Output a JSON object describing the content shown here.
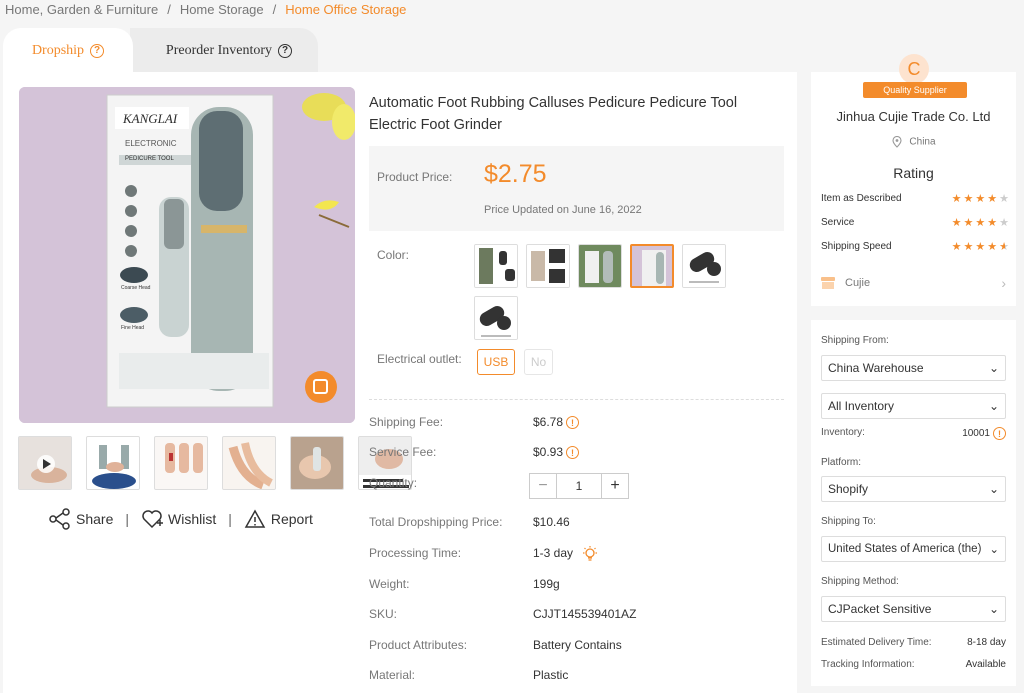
{
  "breadcrumb": {
    "items": [
      "Home, Garden & Furniture",
      "Home Storage"
    ],
    "current": "Home Office Storage",
    "separator": "/"
  },
  "tabs": [
    {
      "label": "Dropship",
      "active": true
    },
    {
      "label": "Preorder Inventory",
      "active": false
    }
  ],
  "colors": {
    "accent": "#f38b2b",
    "text": "#333333",
    "muted": "#777777"
  },
  "product": {
    "title": "Automatic Foot Rubbing Calluses Pedicure Pedicure Tool Electric Foot Grinder",
    "price_label": "Product Price:",
    "price": "$2.75",
    "price_updated": "Price Updated on June 16, 2022",
    "color_label": "Color:",
    "outlet_label": "Electrical outlet:",
    "outlet_options": [
      "USB",
      "No"
    ],
    "package_text": {
      "brand": "KANGLAI",
      "line1": "ELECTRONIC",
      "line2": "PEDICURE TOOL",
      "coarse": "Coarse Head",
      "fine": "Fine Head"
    }
  },
  "actions": {
    "share": "Share",
    "wishlist": "Wishlist",
    "report": "Report",
    "sep": "|"
  },
  "details": {
    "shipping_fee_label": "Shipping Fee:",
    "shipping_fee": "$6.78",
    "service_fee_label": "Service Fee:",
    "service_fee": "$0.93",
    "quantity_label": "Quantity:",
    "quantity": "1",
    "total_label": "Total Dropshipping Price:",
    "total": "$10.46",
    "processing_label": "Processing Time:",
    "processing": "1-3 day",
    "weight_label": "Weight:",
    "weight": "199g",
    "sku_label": "SKU:",
    "sku": "CJJT145539401AZ",
    "attributes_label": "Product Attributes:",
    "attributes": "Battery Contains",
    "material_label": "Material:",
    "material": "Plastic"
  },
  "supplier": {
    "initial": "C",
    "badge": "Quality Supplier",
    "name": "Jinhua Cujie Trade Co. Ltd",
    "location": "China",
    "rating_title": "Rating",
    "ratings": [
      {
        "label": "Item as Described",
        "stars": 4
      },
      {
        "label": "Service",
        "stars": 4
      },
      {
        "label": "Shipping Speed",
        "stars": 4.5
      }
    ],
    "shop": "Cujie"
  },
  "shipping": {
    "from_label": "Shipping From:",
    "from": "China Warehouse",
    "inventory_select": "All Inventory",
    "inventory_label": "Inventory:",
    "inventory": "10001",
    "platform_label": "Platform:",
    "platform": "Shopify",
    "to_label": "Shipping To:",
    "to": "United States of America (the)",
    "method_label": "Shipping Method:",
    "method": "CJPacket Sensitive",
    "delivery_label": "Estimated Delivery Time:",
    "delivery": "8-18 day",
    "tracking_label": "Tracking Information:",
    "tracking": "Available"
  }
}
